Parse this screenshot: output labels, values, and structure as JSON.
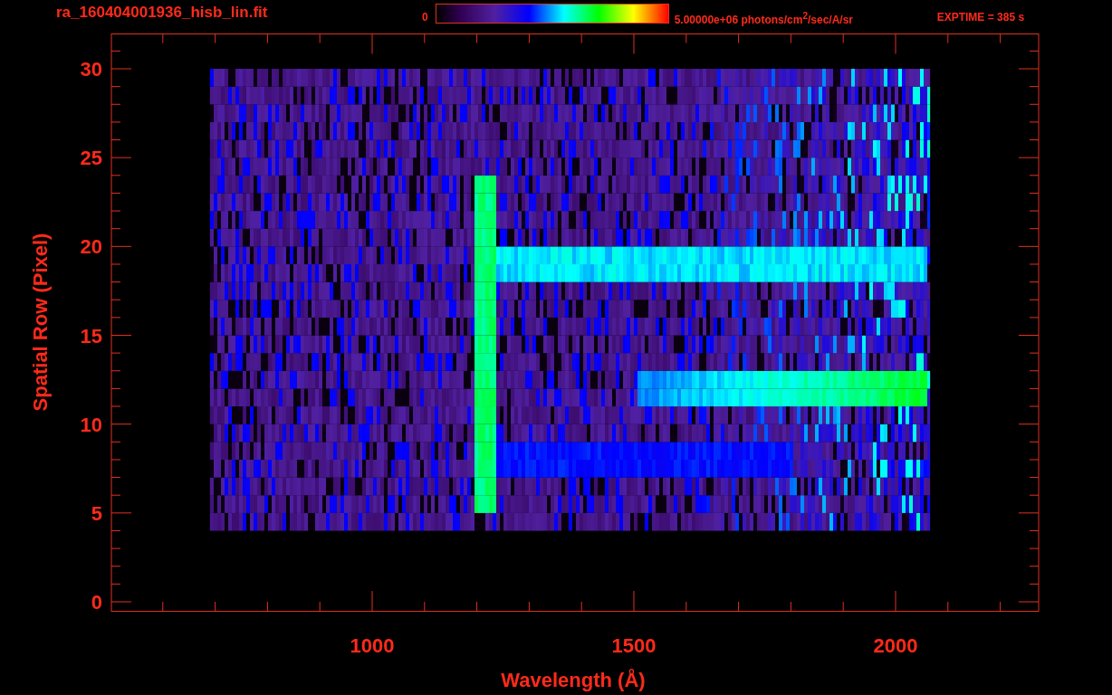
{
  "header": {
    "title": "ra_160404001936_hisb_lin.fit",
    "colorbar_min": "0",
    "colorbar_max": "5.00000e+06 photons/cm$^{2}$/sec/A/sr",
    "exposure": "EXPTIME = 385 s"
  },
  "plot": {
    "ylabel": "Spatial Row (Pixel)",
    "xlabel": "Wavelength (Å)",
    "yticks": [
      "30",
      "25",
      "20",
      "15",
      "10",
      "5",
      "0"
    ],
    "xticks": [
      "1000",
      "1500",
      "2000"
    ]
  }
}
